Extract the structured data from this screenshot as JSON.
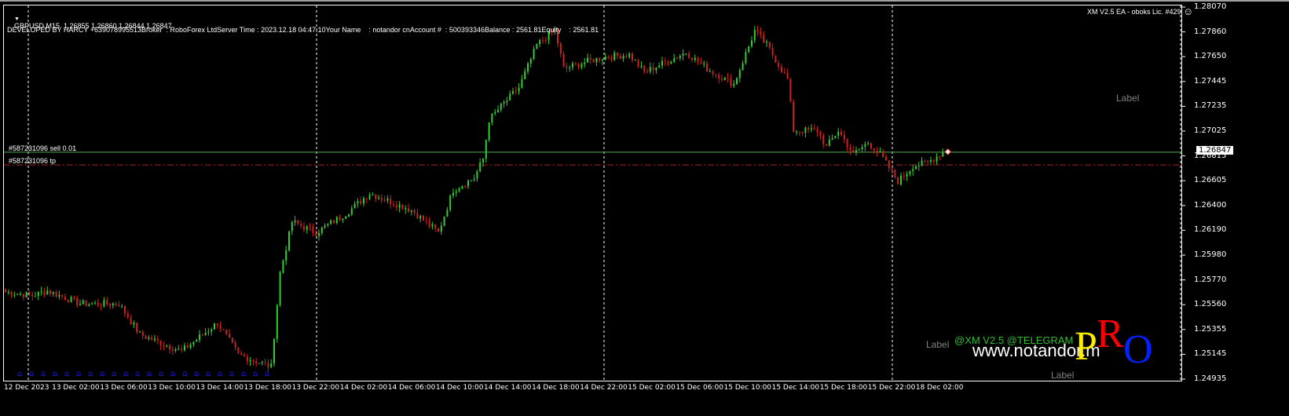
{
  "header": {
    "symbol_line": "GBPUSD,M15  1.26855 1.26860 1.26844 1.26847",
    "info_line": "DEVELOPED BY HARCY +639078995513Broker  : RoboForex LtdServer Time : 2023.12.18 04:47:10Your Name    : notandor cnAccount #  : 500393346Balance : 2561.81Equity    : 2561.81",
    "ea_label": "XM V2.5 EA - oboks Lic. #429",
    "smiley_icon": "smiley-face-icon"
  },
  "orders": {
    "sell_label": "#587231096 sell 0.01",
    "tp_label": "#587231096 tp",
    "current_price": "1.26847"
  },
  "overlay": {
    "label_1": "Label",
    "label_2": "Label",
    "label_3": "Label",
    "telegram": "@XM V2.5 @TELEGRAM",
    "website": "www.notandor.m",
    "logo": "PRO"
  },
  "price_axis": [
    "1.28070",
    "1.27860",
    "1.27650",
    "1.27445",
    "1.27235",
    "1.27025",
    "1.26815",
    "1.26605",
    "1.26400",
    "1.26190",
    "1.25980",
    "1.25770",
    "1.25560",
    "1.25355",
    "1.25145",
    "1.24935"
  ],
  "time_axis": [
    "12 Dec 2023",
    "13 Dec 02:00",
    "13 Dec 06:00",
    "13 Dec 10:00",
    "13 Dec 14:00",
    "13 Dec 18:00",
    "13 Dec 22:00",
    "14 Dec 02:00",
    "14 Dec 06:00",
    "14 Dec 10:00",
    "14 Dec 14:00",
    "14 Dec 18:00",
    "14 Dec 22:00",
    "15 Dec 02:00",
    "15 Dec 06:00",
    "15 Dec 10:00",
    "15 Dec 14:00",
    "15 Dec 18:00",
    "15 Dec 22:00",
    "18 Dec 02:00"
  ],
  "colors": {
    "bull": "#33cc33",
    "bear": "#cc2222",
    "order_line": "#55aa55",
    "tp_line": "#aa2222",
    "grid": "#ffffff"
  },
  "chart_data": {
    "type": "candlestick",
    "symbol": "GBPUSD",
    "timeframe": "M15",
    "ylim": [
      1.24935,
      1.2807
    ],
    "sell_price": 1.26847,
    "tp_price": 1.2674,
    "close_path": [
      [
        0,
        1.2567
      ],
      [
        9,
        1.2564
      ],
      [
        14,
        1.2568
      ],
      [
        25,
        1.2557
      ],
      [
        38,
        1.2557
      ],
      [
        45,
        1.2531
      ],
      [
        59,
        1.2517
      ],
      [
        71,
        1.2541
      ],
      [
        78,
        1.2514
      ],
      [
        89,
        1.2504
      ],
      [
        92,
        1.2583
      ],
      [
        96,
        1.2626
      ],
      [
        104,
        1.2617
      ],
      [
        114,
        1.2633
      ],
      [
        122,
        1.265
      ],
      [
        136,
        1.2636
      ],
      [
        145,
        1.2617
      ],
      [
        150,
        1.2653
      ],
      [
        157,
        1.2663
      ],
      [
        160,
        1.2679
      ],
      [
        162,
        1.2712
      ],
      [
        167,
        1.2726
      ],
      [
        172,
        1.2739
      ],
      [
        178,
        1.2775
      ],
      [
        184,
        1.2788
      ],
      [
        187,
        1.2755
      ],
      [
        196,
        1.2762
      ],
      [
        201,
        1.2765
      ],
      [
        209,
        1.2767
      ],
      [
        214,
        1.2752
      ],
      [
        228,
        1.2769
      ],
      [
        235,
        1.2755
      ],
      [
        244,
        1.2742
      ],
      [
        251,
        1.2787
      ],
      [
        255,
        1.2775
      ],
      [
        262,
        1.2746
      ],
      [
        264,
        1.2703
      ],
      [
        272,
        1.2703
      ],
      [
        275,
        1.2689
      ],
      [
        279,
        1.2703
      ],
      [
        284,
        1.2683
      ],
      [
        289,
        1.2693
      ],
      [
        293,
        1.2683
      ],
      [
        299,
        1.266
      ],
      [
        304,
        1.2673
      ],
      [
        309,
        1.2676
      ],
      [
        314,
        1.2685
      ]
    ]
  }
}
